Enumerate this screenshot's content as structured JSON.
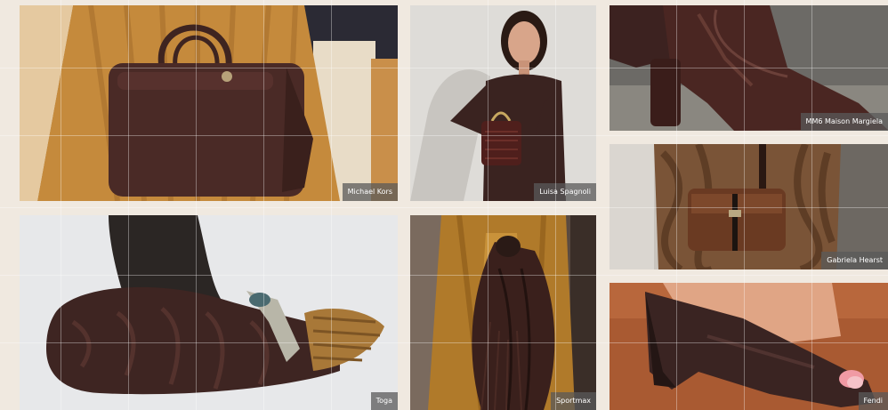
{
  "captions": {
    "michael_kors": "Michael Kors",
    "luisa_spagnoli": "Luisa Spagnoli",
    "mm6": "MM6 Maison Margiela",
    "gabriela_hearst": "Gabriela Hearst",
    "toga": "Toga",
    "sportmax": "Sportmax",
    "fendi": "Fendi"
  },
  "colors": {
    "page_background": "#f0e9e0",
    "caption_background": "#5a5a5a",
    "caption_text": "#ffffff",
    "leather_brown": "#4a2a26"
  }
}
